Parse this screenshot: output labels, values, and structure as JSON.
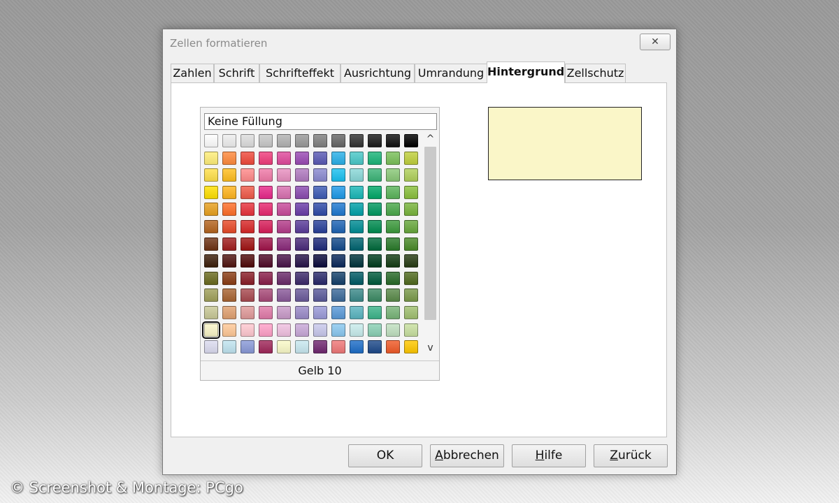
{
  "dialog": {
    "title": "Zellen formatieren",
    "close_symbol": "✕"
  },
  "tabs": [
    {
      "label": "Zahlen"
    },
    {
      "label": "Schrift"
    },
    {
      "label": "Schrifteffekt"
    },
    {
      "label": "Ausrichtung"
    },
    {
      "label": "Umrandung"
    },
    {
      "label": "Hintergrund",
      "active": true
    },
    {
      "label": "Zellschutz"
    }
  ],
  "palette": {
    "no_fill_label": "Keine Füllung",
    "selected_color_name": "Gelb 10",
    "selected_color": "#FAF6C8",
    "scroll_up_symbol": "^",
    "scroll_down_symbol": "v",
    "rows": [
      [
        "#ffffff",
        "#eeeeee",
        "#dddddd",
        "#c8c8c8",
        "#b2b2b2",
        "#999999",
        "#808080",
        "#666666",
        "#333333",
        "#1c1c1c",
        "#111111",
        "#000000"
      ],
      [
        "#ffee78",
        "#ff8a3c",
        "#f04a3c",
        "#f03c7c",
        "#e04a9c",
        "#9a4ab4",
        "#5a5ab4",
        "#2ab0e8",
        "#4ac8c8",
        "#1ab478",
        "#7ac05a",
        "#c0d03c"
      ],
      [
        "#ffe04a",
        "#ffbe1e",
        "#ff8a8a",
        "#f07aa8",
        "#e890c0",
        "#b07ac0",
        "#8a8ad0",
        "#1ac0f0",
        "#8ad8d8",
        "#3cb478",
        "#8ac878",
        "#b0d05a"
      ],
      [
        "#ffe000",
        "#ffb41e",
        "#f05a4a",
        "#e8288a",
        "#d870b0",
        "#8a4ab0",
        "#3c5ab4",
        "#1e9ae8",
        "#1ab8b8",
        "#00a868",
        "#5ab45a",
        "#8ac03c"
      ],
      [
        "#e8a01e",
        "#ff6e28",
        "#e8323c",
        "#e82870",
        "#c84a9a",
        "#6a3ca8",
        "#2e4aa8",
        "#1e78d0",
        "#00a0a8",
        "#009860",
        "#4aa84a",
        "#78b43c"
      ],
      [
        "#b4641e",
        "#e84a28",
        "#d82828",
        "#d81e5a",
        "#b43c8a",
        "#5a3c9a",
        "#28409a",
        "#1e64b4",
        "#008c94",
        "#008c50",
        "#3c9a3c",
        "#68a83c"
      ],
      [
        "#6e3214",
        "#a01e1e",
        "#a01414",
        "#a0144a",
        "#8a2a7a",
        "#4a2a7a",
        "#1e2a7a",
        "#144a8a",
        "#006470",
        "#006a3c",
        "#2a7a2a",
        "#4a8a28"
      ],
      [
        "#3c1e0a",
        "#501410",
        "#500a0a",
        "#500a28",
        "#4a144a",
        "#28144a",
        "#0a0a3c",
        "#0a285a",
        "#00343c",
        "#003c1e",
        "#143c14",
        "#283c14"
      ],
      [
        "#6a6a1e",
        "#8a3c14",
        "#8a1e28",
        "#8a1e4a",
        "#6a2a6a",
        "#3c2a6a",
        "#28286a",
        "#14406a",
        "#005a64",
        "#005a3c",
        "#286a28",
        "#506a1e"
      ],
      [
        "#a0a05a",
        "#a86432",
        "#a84a50",
        "#a84a78",
        "#8a5a9a",
        "#6a5a9a",
        "#5a5a9a",
        "#3c6a9a",
        "#3c8a8a",
        "#3c8a64",
        "#5a8a4a",
        "#7a9a4a"
      ],
      [
        "#c8c896",
        "#e0a070",
        "#e09a9a",
        "#e07aa8",
        "#c89ac8",
        "#9a8ac8",
        "#9a9ad8",
        "#5a9ad8",
        "#5ab4c0",
        "#3cb48a",
        "#78b478",
        "#a0c070"
      ],
      [
        "#faf6c8",
        "#ffc896",
        "#ffc8d0",
        "#ffa0c8",
        "#f0c0e0",
        "#c8a8d8",
        "#c8c8ec",
        "#8ac8f0",
        "#c8ecec",
        "#8ad0b4",
        "#c0e0c0",
        "#c8e0a0"
      ],
      [
        "#dcdcf0",
        "#c0e4f0",
        "#8a9ad8",
        "#a0285a",
        "#fafac8",
        "#c8e8f0",
        "#702870",
        "#f07878",
        "#1e6ec8",
        "#1e4a8a",
        "#f05a28",
        "#ffc800"
      ]
    ],
    "selected_row": 11,
    "selected_col": 0
  },
  "buttons": {
    "ok": "OK",
    "cancel_mnemonic": "A",
    "cancel_rest": "bbrechen",
    "help_mnemonic": "H",
    "help_rest": "ilfe",
    "back_mnemonic": "Z",
    "back_rest": "urück"
  },
  "watermark": "© Screenshot & Montage: PCgo"
}
